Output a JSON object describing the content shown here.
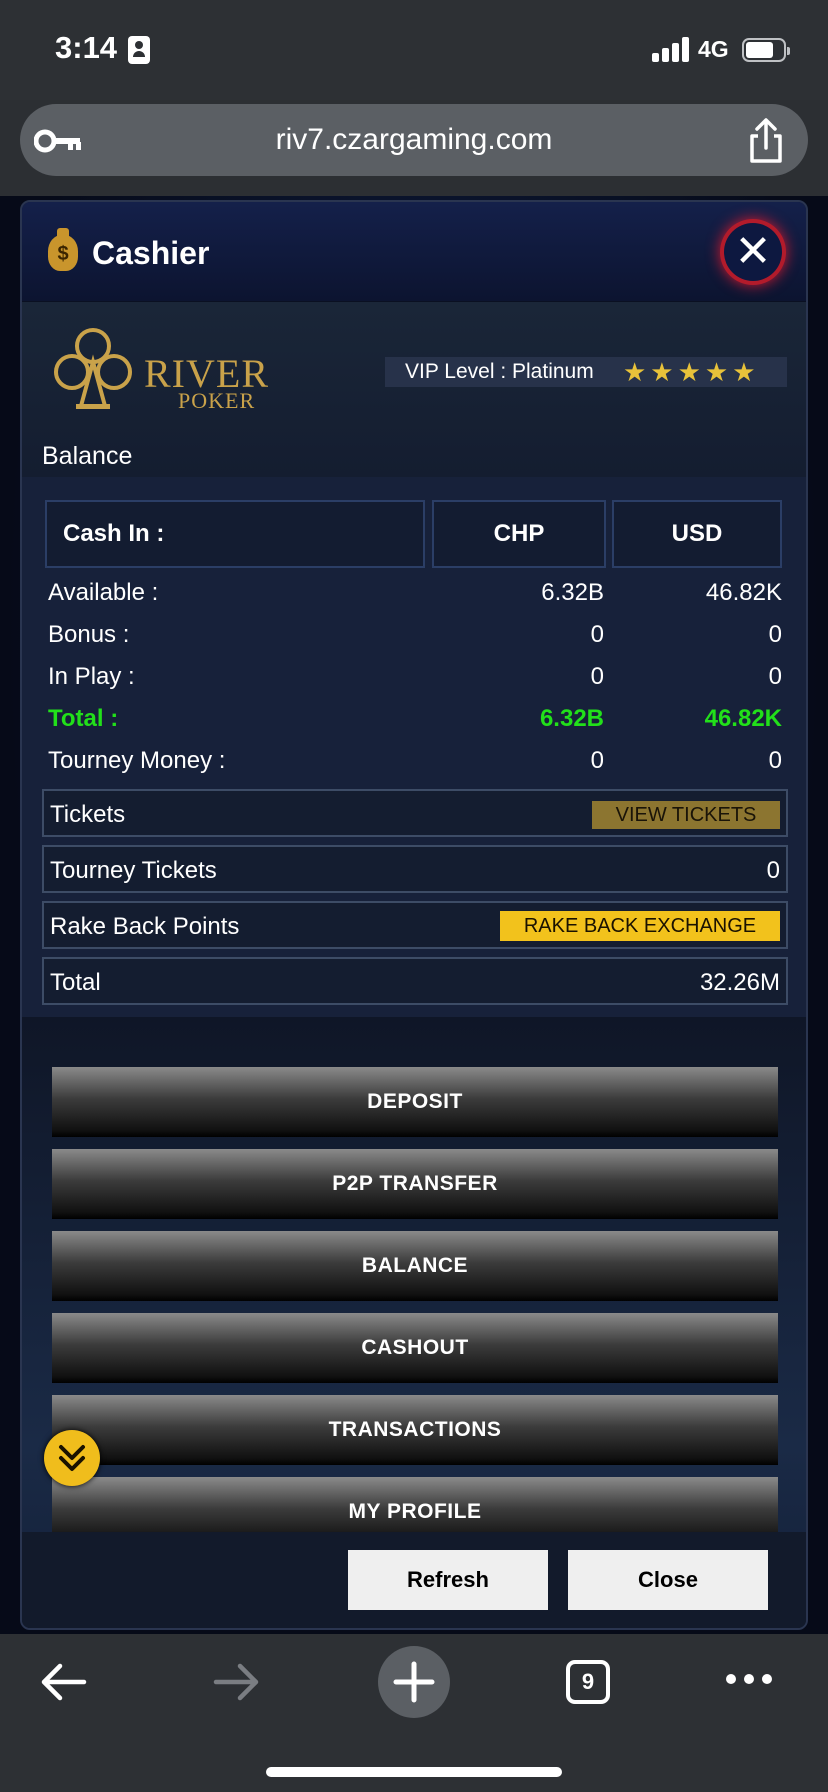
{
  "status_bar": {
    "time": "3:14",
    "network": "4G"
  },
  "browser": {
    "url": "riv7.czargaming.com",
    "tab_count": "9"
  },
  "modal": {
    "title": "Cashier",
    "logo": {
      "brand": "RIVER",
      "sub": "POKER"
    },
    "vip": {
      "label": "VIP Level :  Platinum",
      "stars": "★★★★★",
      "star_count": 5
    },
    "balance_caption": "Balance",
    "balance_table": {
      "header": {
        "label": "Cash In :",
        "col1": "CHP",
        "col2": "USD"
      },
      "rows": [
        {
          "label": "Available :",
          "chp": "6.32B",
          "usd": "46.82K"
        },
        {
          "label": "Bonus :",
          "chp": "0",
          "usd": "0"
        },
        {
          "label": "In Play :",
          "chp": "0",
          "usd": "0"
        },
        {
          "label": "Total :",
          "chp": "6.32B",
          "usd": "46.82K"
        },
        {
          "label": "Tourney Money :",
          "chp": "0",
          "usd": "0"
        }
      ]
    },
    "tickets": {
      "label": "Tickets",
      "button": "VIEW TICKETS"
    },
    "tourney_tickets": {
      "label": "Tourney Tickets",
      "value": "0"
    },
    "rake_back": {
      "label": "Rake Back Points",
      "button": "RAKE BACK EXCHANGE"
    },
    "total": {
      "label": "Total",
      "value": "32.26M"
    },
    "menu": [
      "DEPOSIT",
      "P2P TRANSFER",
      "BALANCE",
      "CASHOUT",
      "TRANSACTIONS",
      "MY PROFILE"
    ],
    "footer": {
      "refresh": "Refresh",
      "close": "Close"
    }
  },
  "colors": {
    "accent_gold": "#f2c21c",
    "total_green": "#22e01a",
    "close_ring": "#b21b2b"
  }
}
